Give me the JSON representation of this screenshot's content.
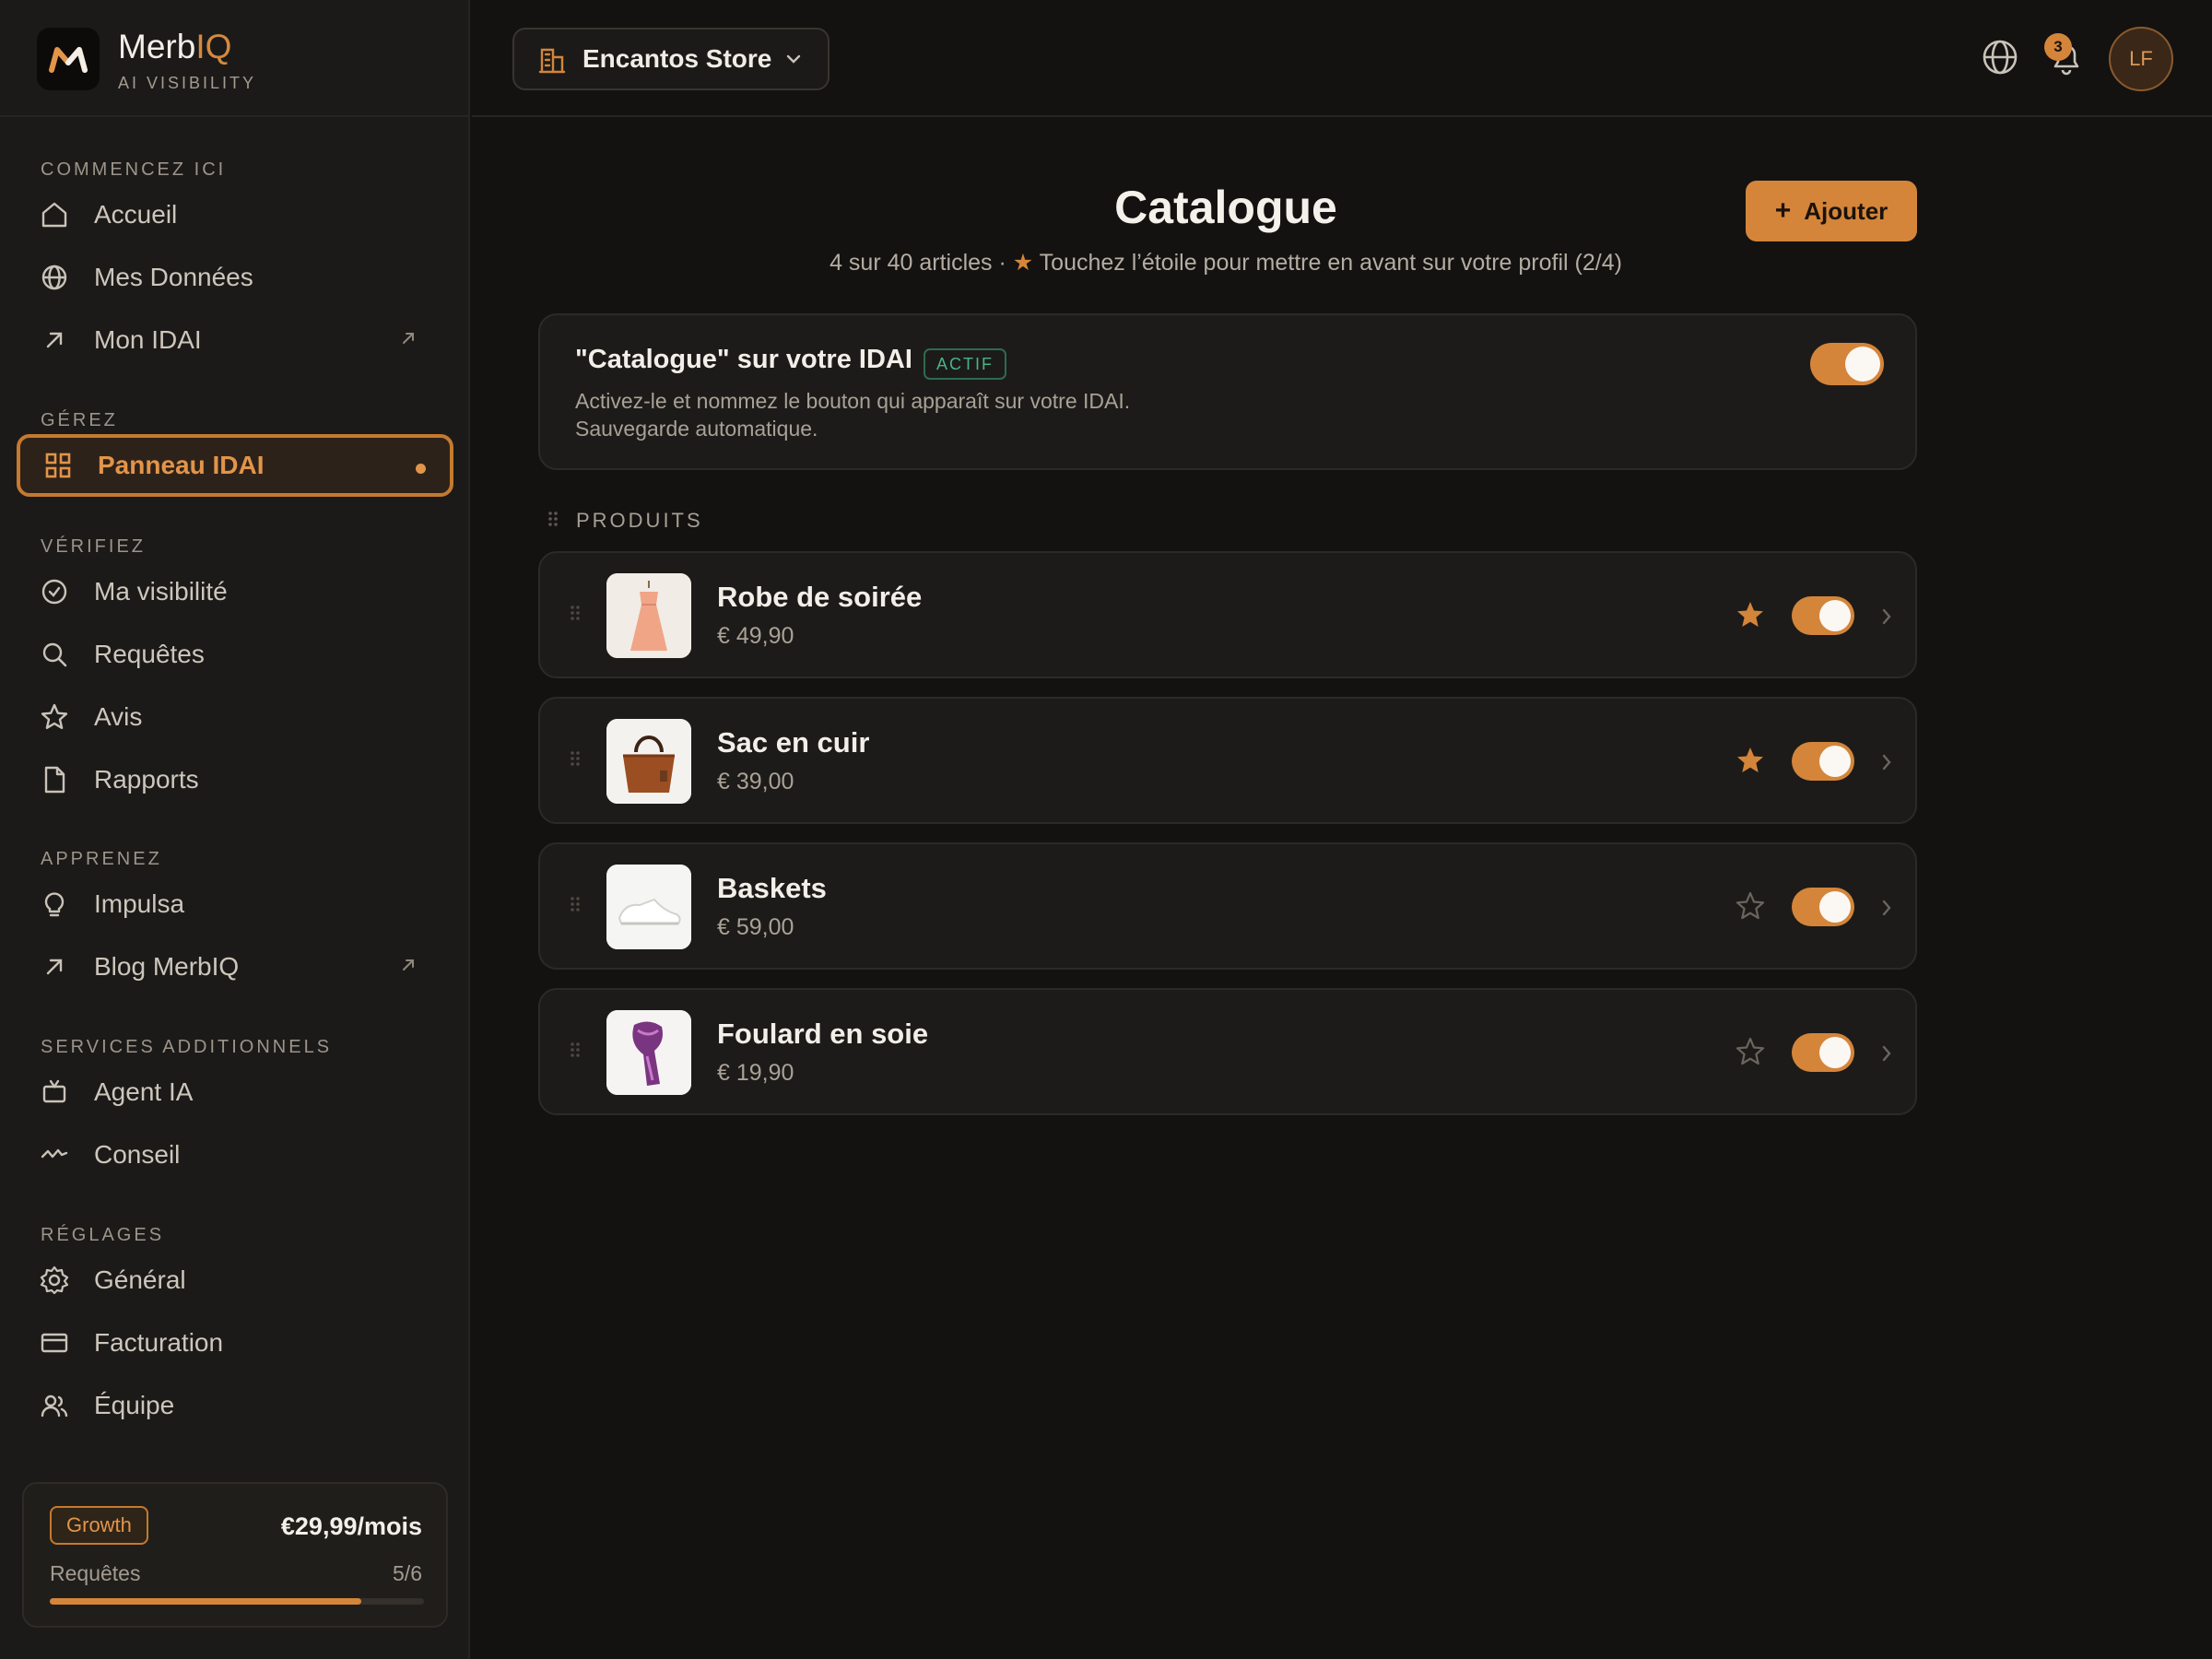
{
  "brand": {
    "name_prefix": "Merb",
    "name_accent": "IQ",
    "subtitle": "AI VISIBILITY"
  },
  "sidebar": {
    "sections": [
      {
        "label": "COMMENCEZ ICI",
        "items": [
          {
            "label": "Accueil",
            "icon": "home-icon"
          },
          {
            "label": "Mes Données",
            "icon": "globe-icon"
          },
          {
            "label": "Mon IDAI",
            "icon": "arrow-up-right-icon",
            "external": true
          }
        ]
      },
      {
        "label": "GÉREZ",
        "items": [
          {
            "label": "Panneau IDAI",
            "icon": "grid-icon",
            "active": true
          }
        ]
      },
      {
        "label": "VÉRIFIEZ",
        "items": [
          {
            "label": "Ma visibilité",
            "icon": "check-circle-icon"
          },
          {
            "label": "Requêtes",
            "icon": "search-icon"
          },
          {
            "label": "Avis",
            "icon": "star-icon"
          },
          {
            "label": "Rapports",
            "icon": "file-icon"
          }
        ]
      },
      {
        "label": "APPRENEZ",
        "items": [
          {
            "label": "Impulsa",
            "icon": "lightbulb-icon"
          },
          {
            "label": "Blog MerbIQ",
            "icon": "arrow-up-right-icon",
            "external": true
          }
        ]
      },
      {
        "label": "SERVICES ADDITIONNELS",
        "items": [
          {
            "label": "Agent IA",
            "icon": "robot-icon"
          },
          {
            "label": "Conseil",
            "icon": "activity-icon"
          }
        ]
      },
      {
        "label": "RÉGLAGES",
        "items": [
          {
            "label": "Général",
            "icon": "gear-icon"
          },
          {
            "label": "Facturation",
            "icon": "credit-card-icon"
          },
          {
            "label": "Équipe",
            "icon": "users-icon"
          }
        ]
      }
    ],
    "plan": {
      "name": "Growth",
      "price": "€29,99/mois",
      "usage_label": "Requêtes",
      "usage_text": "5/6",
      "usage_fraction": 0.833
    }
  },
  "topbar": {
    "store": "Encantos Store",
    "notifications_count": "3",
    "avatar_initials": "LF"
  },
  "main": {
    "title": "Catalogue",
    "subtitle_prefix": "4 sur 40 articles · ",
    "subtitle_star": "★",
    "subtitle_suffix": " Touchez l’étoile pour mettre en avant sur votre profil (2/4)",
    "add_button": "Ajouter",
    "feature": {
      "title": "\"Catalogue\" sur votre IDAI",
      "badge": "ACTIF",
      "desc_line1": "Activez-le et nommez le bouton qui apparaît sur votre IDAI.",
      "desc_line2": "Sauvegarde automatique.",
      "enabled": true
    },
    "section_label": "PRODUITS",
    "products": [
      {
        "name": "Robe de soirée",
        "price": "€ 49,90",
        "featured": true,
        "enabled": true,
        "image": "dress"
      },
      {
        "name": "Sac en cuir",
        "price": "€ 39,00",
        "featured": true,
        "enabled": true,
        "image": "bag"
      },
      {
        "name": "Baskets",
        "price": "€ 59,00",
        "featured": false,
        "enabled": true,
        "image": "sneakers"
      },
      {
        "name": "Foulard en soie",
        "price": "€ 19,90",
        "featured": false,
        "enabled": true,
        "image": "scarf"
      }
    ]
  },
  "colors": {
    "accent": "#d4853a",
    "background": "#131211",
    "sidebar": "#1b1a18",
    "card": "#1c1b19",
    "success": "#48b486"
  }
}
